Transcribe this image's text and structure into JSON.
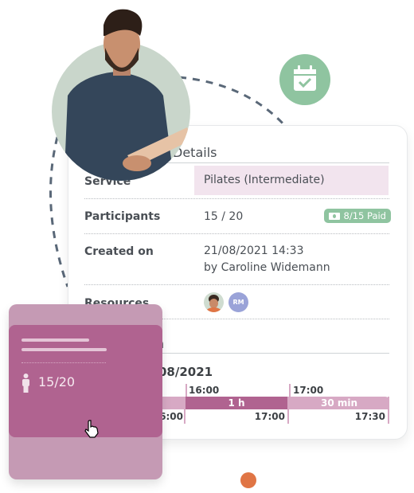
{
  "details": {
    "section_title": "Details",
    "rows": [
      {
        "label": "Service",
        "value": "Pilates (Intermediate)"
      },
      {
        "label": "Participants",
        "value": "15 / 20",
        "badge": "8/15 Paid"
      },
      {
        "label": "Created on",
        "value": "21/08/2021 14:33",
        "value2": "by Caroline Widemann"
      },
      {
        "label": "Resources",
        "avatars": [
          "photo",
          "RM"
        ]
      }
    ]
  },
  "schedule": {
    "section_title_fragment": "n",
    "date_fragment": "08/2021",
    "slots": [
      {
        "end": "16:00",
        "end_fragment": "6:00"
      },
      {
        "start": "16:00",
        "duration": "1 h",
        "end": "17:00"
      },
      {
        "start": "17:00",
        "duration": "30 min",
        "end": "17:30"
      }
    ]
  },
  "overlay_card": {
    "participants": "15/20"
  },
  "colors": {
    "accent_dark": "#b06390",
    "accent_light": "#c59ab4",
    "green": "#8fc4a0",
    "orange": "#e07545",
    "service_highlight": "#f2e4ee"
  },
  "icons": [
    "calendar-check-icon",
    "banknote-icon",
    "person-icon",
    "hand-cursor-icon"
  ]
}
